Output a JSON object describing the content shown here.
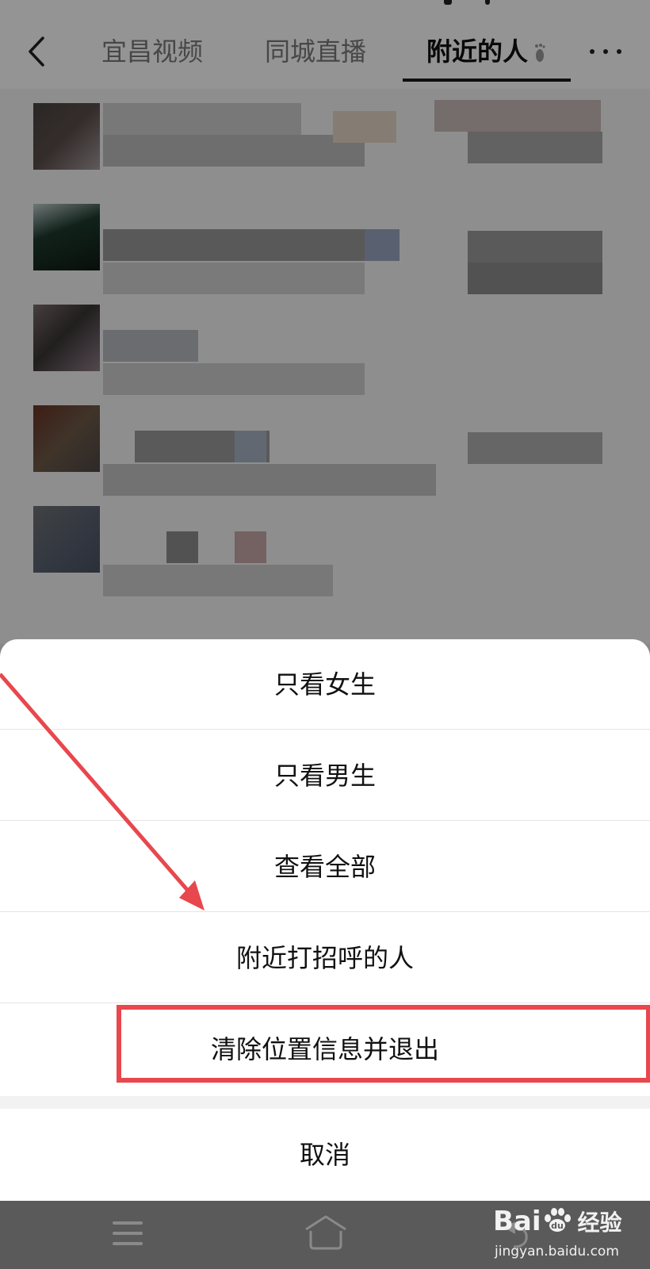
{
  "header": {
    "tabs": [
      {
        "label": "宜昌视频"
      },
      {
        "label": "同城直播"
      },
      {
        "label": "附近的人"
      }
    ],
    "active_tab": "附近的人"
  },
  "action_sheet": {
    "items": [
      {
        "label": "只看女生"
      },
      {
        "label": "只看男生"
      },
      {
        "label": "查看全部"
      },
      {
        "label": "附近打招呼的人"
      },
      {
        "label": "清除位置信息并退出"
      }
    ],
    "cancel_label": "取消"
  },
  "watermark": {
    "brand": "Bai",
    "brand_suffix": "经验",
    "url": "jingyan.baidu.com"
  },
  "colors": {
    "annotation_red": "#e8474d",
    "overlay_dim": "rgba(0,0,0,0.42)",
    "nav_bar": "#5a5a5a"
  },
  "icons": [
    "back-icon",
    "more-icon",
    "footprint-icon",
    "menu-icon",
    "home-icon",
    "back-nav-icon",
    "baidu-paw-icon"
  ]
}
